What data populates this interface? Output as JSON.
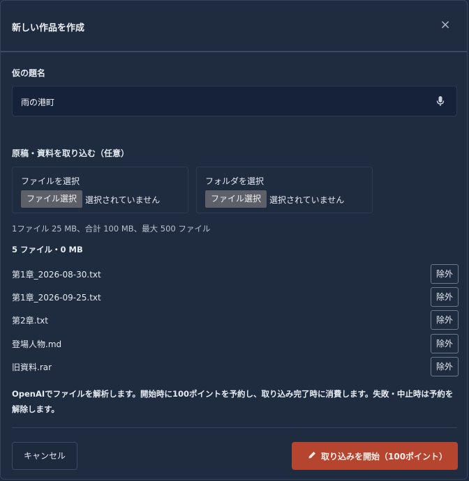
{
  "dialog": {
    "title": "新しい作品を作成",
    "close_label": "×"
  },
  "title_field": {
    "label": "仮の題名",
    "value": "雨の港町",
    "icon": "microphone-icon"
  },
  "import": {
    "label": "原稿・資料を取り込む（任意）",
    "file_picker": {
      "label": "ファイルを選択",
      "button": "ファイル選択",
      "status": "選択されていません"
    },
    "folder_picker": {
      "label": "フォルダを選択",
      "button": "ファイル選択",
      "status": "選択されていません"
    },
    "limits": "1ファイル 25 MB、合計 100 MB、最大 500 ファイル",
    "summary": "5 ファイル・0 MB",
    "files": [
      {
        "name": "第1章_2026-08-30.txt",
        "action": "除外"
      },
      {
        "name": "第1章_2026-09-25.txt",
        "action": "除外"
      },
      {
        "name": "第2章.txt",
        "action": "除外"
      },
      {
        "name": "登場人物.md",
        "action": "除外"
      },
      {
        "name": "旧資料.rar",
        "action": "除外"
      }
    ]
  },
  "notice": "OpenAIでファイルを解析します。開始時に100ポイントを予約し、取り込み完了時に消費します。失敗・中止時は予約を解除します。",
  "footer": {
    "cancel": "キャンセル",
    "start": "取り込みを開始（100ポイント）",
    "start_icon": "pen-icon"
  },
  "colors": {
    "background": "#1f2b3f",
    "input_background": "#16223a",
    "accent": "#b5452f"
  }
}
